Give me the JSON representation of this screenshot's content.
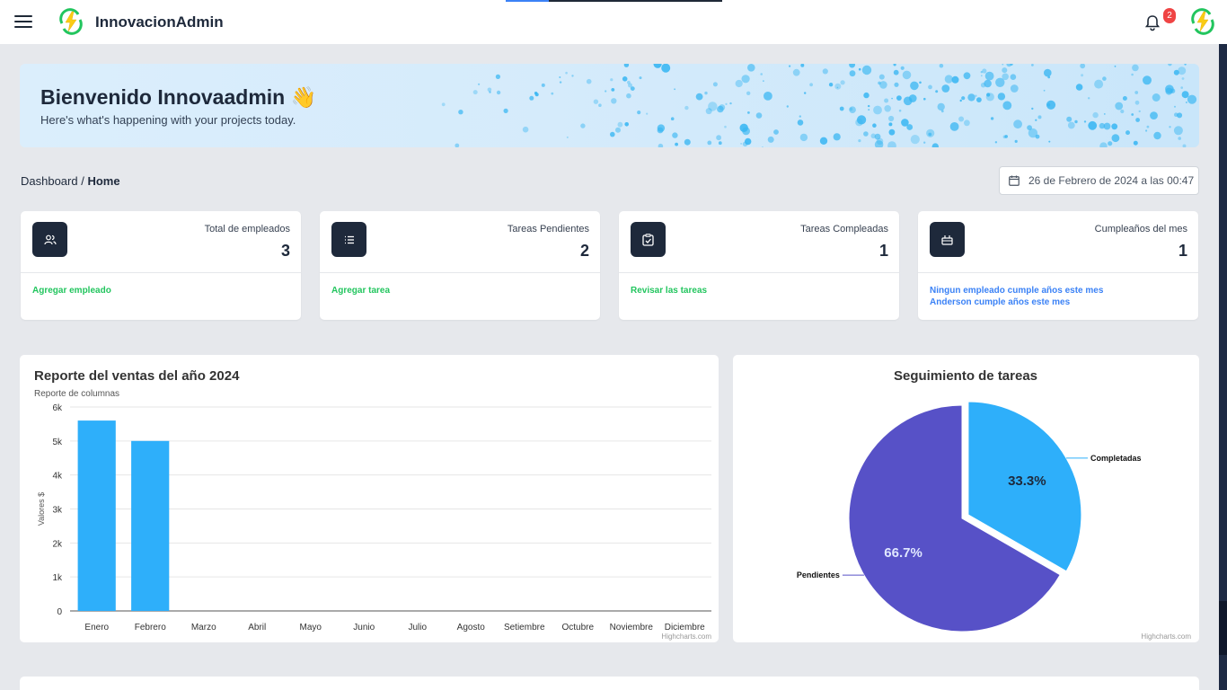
{
  "app": {
    "brand": "InnovacionAdmin",
    "notification_count": "2"
  },
  "banner": {
    "title": "Bienvenido Innovaadmin 👋",
    "subtitle": "Here's what's happening with your projects today."
  },
  "breadcrumb": {
    "parent": "Dashboard",
    "separator": " / ",
    "current": "Home"
  },
  "date_text": "26 de Febrero de 2024 a las 00:47",
  "cards": [
    {
      "label": "Total de empleados",
      "value": "3",
      "link": "Agregar empleado",
      "icon": "users-icon"
    },
    {
      "label": "Tareas Pendientes",
      "value": "2",
      "link": "Agregar tarea",
      "icon": "list-icon"
    },
    {
      "label": "Tareas Compleadas",
      "value": "1",
      "link": "Revisar las tareas",
      "icon": "clipboard-check-icon"
    },
    {
      "label": "Cumpleaños del mes",
      "value": "1",
      "link": "Ningun empleado cumple años este mes",
      "link2": "Anderson cumple años este mes",
      "icon": "cake-icon"
    }
  ],
  "colors": {
    "accent_green": "#22c55e",
    "accent_blue": "#3b82f6",
    "bar": "#2eaffa",
    "pie_pending": "#5751c7",
    "pie_done": "#2eaffa"
  },
  "chart_data": [
    {
      "type": "bar",
      "title": "Reporte del ventas del año 2024",
      "subtitle": "Reporte de columnas",
      "ylabel": "Valores $",
      "categories": [
        "Enero",
        "Febrero",
        "Marzo",
        "Abril",
        "Mayo",
        "Junio",
        "Julio",
        "Agosto",
        "Setiembre",
        "Octubre",
        "Noviembre",
        "Diciembre"
      ],
      "values": [
        5600,
        5000,
        0,
        0,
        0,
        0,
        0,
        0,
        0,
        0,
        0,
        0
      ],
      "ylim": [
        0,
        6000
      ],
      "yticks": [
        "0",
        "1k",
        "2k",
        "3k",
        "4k",
        "5k",
        "6k"
      ],
      "credit": "Highcharts.com",
      "grid": true
    },
    {
      "type": "pie",
      "title": "Seguimiento de tareas",
      "slices": [
        {
          "name": "Completadas",
          "value": 33.3,
          "label": "33.3%"
        },
        {
          "name": "Pendientes",
          "value": 66.7,
          "label": "66.7%"
        }
      ],
      "credit": "Highcharts.com"
    }
  ]
}
